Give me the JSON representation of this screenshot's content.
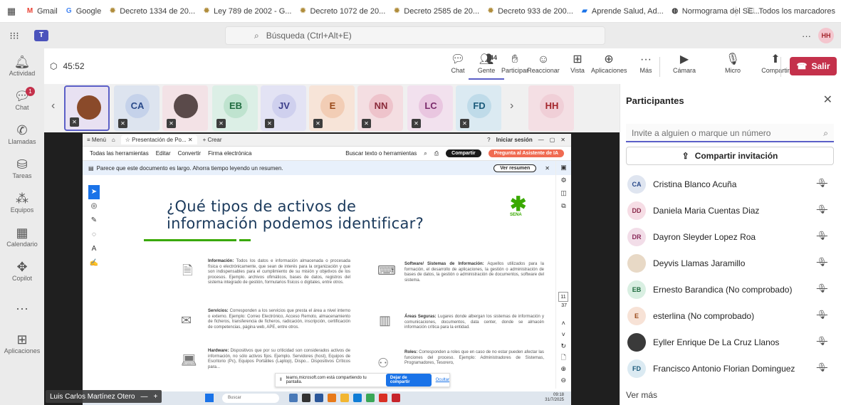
{
  "bookmarks": {
    "items": [
      {
        "label": "Gmail",
        "icon": "gmail-icon",
        "color": "#ea4335",
        "glyph": "M"
      },
      {
        "label": "Google",
        "icon": "google-icon",
        "color": "#4285f4",
        "glyph": "G"
      },
      {
        "label": "Decreto 1334 de 20...",
        "icon": "seal-icon",
        "color": "#b08d3c",
        "glyph": "✹"
      },
      {
        "label": "Ley 789 de 2002 - G...",
        "icon": "seal-icon",
        "color": "#b08d3c",
        "glyph": "✹"
      },
      {
        "label": "Decreto 1072 de 20...",
        "icon": "seal-icon",
        "color": "#b08d3c",
        "glyph": "✹"
      },
      {
        "label": "Decreto 2585 de 20...",
        "icon": "seal-icon",
        "color": "#b08d3c",
        "glyph": "✹"
      },
      {
        "label": "Decreto 933 de 200...",
        "icon": "seal-icon",
        "color": "#b08d3c",
        "glyph": "✹"
      },
      {
        "label": "Aprende Salud, Ad...",
        "icon": "aprende-icon",
        "color": "#1a73e8",
        "glyph": "▰"
      },
      {
        "label": "Normograma del SE...",
        "icon": "globe-icon",
        "color": "#333333",
        "glyph": "◍"
      }
    ],
    "all_bookmarks": "Todos los marcadores"
  },
  "teams": {
    "search_placeholder": "Búsqueda (Ctrl+Alt+E)",
    "more": "···",
    "user_initials": "HH"
  },
  "rail": [
    {
      "label": "Actividad",
      "icon": "bell-icon",
      "glyph": "🔔︎"
    },
    {
      "label": "Chat",
      "icon": "chat-icon",
      "glyph": "💬︎",
      "badge": "1"
    },
    {
      "label": "Llamadas",
      "icon": "phone-icon",
      "glyph": "✆"
    },
    {
      "label": "Tareas",
      "icon": "tasks-icon",
      "glyph": "⛁"
    },
    {
      "label": "Equipos",
      "icon": "teams-icon",
      "glyph": "⁂"
    },
    {
      "label": "Calendario",
      "icon": "calendar-icon",
      "glyph": "▦"
    },
    {
      "label": "Copilot",
      "icon": "copilot-icon",
      "glyph": "✥"
    },
    {
      "label": "",
      "icon": "more-icon",
      "glyph": "···"
    },
    {
      "label": "Aplicaciones",
      "icon": "add-apps-icon",
      "glyph": "⊞"
    }
  ],
  "meeting": {
    "timer": "45:52",
    "people_count": "44",
    "toolbar": [
      {
        "label": "Chat",
        "icon": "chat-icon",
        "glyph": "💬︎"
      },
      {
        "label": "Gente",
        "icon": "people-icon",
        "glyph": "👥︎"
      },
      {
        "label": "Participar",
        "icon": "raise-hand-icon",
        "glyph": "✋︎"
      },
      {
        "label": "Reaccionar",
        "icon": "smile-icon",
        "glyph": "☺"
      },
      {
        "label": "Vista",
        "icon": "view-icon",
        "glyph": "⊞"
      },
      {
        "label": "Aplicaciones",
        "icon": "apps-icon",
        "glyph": "⊕"
      },
      {
        "label": "Más",
        "icon": "more-icon",
        "glyph": "···"
      },
      {
        "label": "Cámara",
        "icon": "camera-off-icon",
        "glyph": "▶"
      },
      {
        "label": "Micro",
        "icon": "mic-off-icon",
        "glyph": "🎙︎"
      },
      {
        "label": "Compartir",
        "icon": "share-icon",
        "glyph": "⬆"
      }
    ],
    "leave_label": "Salir"
  },
  "strip": [
    {
      "initials": "",
      "bg": "#e8e1f2",
      "avatar_bg": "#8a4a2a",
      "photo": true
    },
    {
      "initials": "CA",
      "bg": "#dde4ef",
      "avatar_bg": "#c5d2ea",
      "color": "#2a4a8a"
    },
    {
      "initials": "",
      "bg": "#f3e2e6",
      "avatar_bg": "#5a4a4a",
      "photo": true
    },
    {
      "initials": "EB",
      "bg": "#dcefe6",
      "avatar_bg": "#bfe3cf",
      "color": "#1f6b3f"
    },
    {
      "initials": "JV",
      "bg": "#e3e3f4",
      "avatar_bg": "#cfd0ee",
      "color": "#3b3d8a"
    },
    {
      "initials": "E",
      "bg": "#f7e4d8",
      "avatar_bg": "#f2cdb5",
      "color": "#9a4a1a"
    },
    {
      "initials": "NN",
      "bg": "#f4dee2",
      "avatar_bg": "#eec3cb",
      "color": "#8a2a3a"
    },
    {
      "initials": "LC",
      "bg": "#f2e1ee",
      "avatar_bg": "#e9c6e0",
      "color": "#7a2a6a"
    },
    {
      "initials": "FD",
      "bg": "#dbeaf2",
      "avatar_bg": "#bfdbe9",
      "color": "#1a5a7a"
    },
    {
      "initials": "HH",
      "bg": "#f4dfe4",
      "avatar_bg": "#f0cfd7",
      "color": "#a4262c"
    }
  ],
  "pdf": {
    "menu": "≡ Menú",
    "tab_title": "Presentación de Po...",
    "new_tab": "+ Crear",
    "signin": "Iniciar sesión",
    "tools": [
      "Todas las herramientas",
      "Editar",
      "Convertir",
      "Firma electrónica"
    ],
    "search_tools": "Buscar texto o herramientas",
    "share": "Compartir",
    "ai": "Pregunta al Asistente de IA",
    "notice": "Parece que este documento es largo. Ahorra tiempo leyendo un resumen.",
    "summary_btn": "Ver resumen",
    "slide_title_1": "¿Qué tipos de activos de",
    "slide_title_2": "información podemos identificar?",
    "logo": "SENA",
    "blocks": [
      {
        "title": "Información:",
        "text": "Todos los datos e información almacenada o procesada física o electrónicamente, que sean de interés para la organización y que son indispensables para el cumplimiento de su misión y objetivos de los procesos. Ejemplo. archivos ofimáticos, bases de datos, registros del sistema integrado de gestión, formularios físicos o digitales, entre otros."
      },
      {
        "title": "Software/ Sistemas de Información:",
        "text": "Aquellos utilizados para la formación, el desarrollo de aplicaciones, la gestión o administración de bases de datos, la gestión o administración de documentos, software del sistema."
      },
      {
        "title": "Servicios:",
        "text": "Corresponden a los servicios que presta el área a nivel interno o externo. Ejemplo: Correo Electrónico, Acceso Remoto, almacenamiento de ficheros, transferencia de ficheros, radicación, inscripción, certificación de competencias, página web, APE, entre otros."
      },
      {
        "title": "Áreas Seguras:",
        "text": "Lugares donde albergan los sistemas de información y comunicaciones, documentos, data center, donde se almacén información crítica para la entidad."
      },
      {
        "title": "Hardware:",
        "text": "Dispositivos que por su criticidad son considerados activos de información, no sólo activos fijos. Ejemplo. Servidores (host), Equipos de Escritorio (Pc), Equipos Portátiles (Laptop), Dispo... Dispositivos Críticos para..."
      },
      {
        "title": "Roles:",
        "text": "Corresponden a roles que en caso de no estar pueden afectar las funciones del proceso. Ejemplo: Administradores de Sistemas, Programadores, Tesorero,"
      }
    ],
    "page_current": "11",
    "page_total": "37",
    "share_notice": "teams.microsoft.com está compartiendo tu pantalla.",
    "stop_sharing": "Dejar de compartir",
    "hide": "Ocultar",
    "taskbar_search": "Buscar",
    "taskbar_time": "09:18",
    "taskbar_date": "31/7/2025",
    "presenter": "Luis Carlos Martínez Otero"
  },
  "panel": {
    "title": "Participantes",
    "invite_placeholder": "Invite a alguien o marque un número",
    "share_invite": "Compartir invitación",
    "participants": [
      {
        "name": "Cristina Blanco Acuña",
        "initials": "CA",
        "bg": "#dfe5f0",
        "color": "#2a4a8a"
      },
      {
        "name": "Daniela Maria Cuentas Diaz",
        "initials": "DD",
        "bg": "#f6dde5",
        "color": "#8a2a4a"
      },
      {
        "name": "Dayron Sleyder Lopez Roa",
        "initials": "DR",
        "bg": "#f2dde8",
        "color": "#8a2a5a"
      },
      {
        "name": "Deyvis Llamas Jaramillo",
        "initials": "",
        "bg": "#e8d9c6",
        "color": "#5a3a1a",
        "photo": true
      },
      {
        "name": "Ernesto Barandica (No comprobado)",
        "initials": "EB",
        "bg": "#d9efe2",
        "color": "#1f6b3f"
      },
      {
        "name": "esterlina (No comprobado)",
        "initials": "E",
        "bg": "#f7e2d6",
        "color": "#9a4a1a"
      },
      {
        "name": "Eyller Enrique De La Cruz Llanos",
        "initials": "",
        "bg": "#3a3a3a",
        "color": "#fff",
        "photo": true
      },
      {
        "name": "Francisco Antonio Florian Dominguez",
        "initials": "FD",
        "bg": "#dbeaf2",
        "color": "#1a5a7a"
      }
    ],
    "see_more": "Ver más"
  }
}
